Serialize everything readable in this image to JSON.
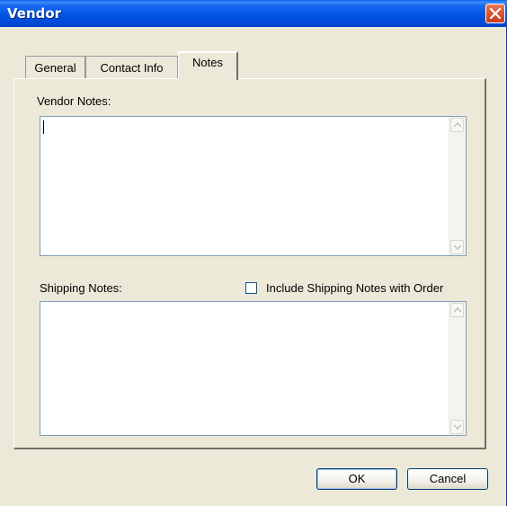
{
  "window": {
    "title": "Vendor"
  },
  "tabs": [
    {
      "label": "General",
      "active": false
    },
    {
      "label": "Contact Info",
      "active": false
    },
    {
      "label": "Notes",
      "active": true
    }
  ],
  "notes_tab": {
    "vendor_notes_label": "Vendor Notes:",
    "vendor_notes_value": "",
    "shipping_notes_label": "Shipping Notes:",
    "shipping_notes_value": "",
    "include_shipping_checkbox": {
      "label": "Include Shipping Notes with Order",
      "checked": false
    }
  },
  "buttons": {
    "ok_label": "OK",
    "cancel_label": "Cancel"
  },
  "icons": {
    "close": "close-icon",
    "scroll_up": "scroll-up-arrow-icon",
    "scroll_down": "scroll-down-arrow-icon"
  },
  "colors": {
    "titlebar": "#0055e5",
    "dialog_bg": "#ece9d8",
    "close_button": "#d8552f",
    "field_border": "#7f9db9"
  }
}
